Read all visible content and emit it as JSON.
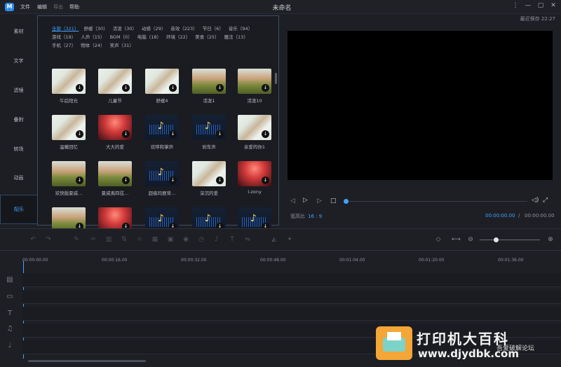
{
  "titlebar": {
    "logo": "M",
    "menu": [
      "文件",
      "编辑",
      "导出",
      "帮助"
    ],
    "title": "未命名",
    "controls": [
      "⋮",
      "—",
      "▢",
      "✕"
    ],
    "saved": "最近保存 22:27"
  },
  "nav": [
    "素材",
    "文字",
    "滤镜",
    "叠附",
    "转场",
    "动画",
    "配乐"
  ],
  "categories": [
    "全部（321）",
    "舒缓（30）",
    "活泼（30）",
    "动感（29）",
    "音效（223）",
    "节日（6）",
    "音乐（94）",
    "游戏（19）",
    "人声（15）",
    "BGM（0）",
    "电脑（18）",
    "环境（22）",
    "美食（25）",
    "魔法（13）",
    "手机（27）",
    "物体（24）",
    "笑声（31）"
  ],
  "items": [
    {
      "label": "午后阳光",
      "type": "flower"
    },
    {
      "label": "儿童节",
      "type": "flower"
    },
    {
      "label": "舒缓4",
      "type": "flower"
    },
    {
      "label": "活泼1",
      "type": "field"
    },
    {
      "label": "活泼10",
      "type": "field"
    },
    {
      "label": "温暖回忆",
      "type": "flower"
    },
    {
      "label": "大大的爱",
      "type": "concert"
    },
    {
      "label": "欢呼和掌声",
      "type": "wave"
    },
    {
      "label": "刹车声",
      "type": "wave"
    },
    {
      "label": "亲爱的你1",
      "type": "flower"
    },
    {
      "label": "欢快版夏威...",
      "type": "field"
    },
    {
      "label": "夏威夷四弦...",
      "type": "field"
    },
    {
      "label": "超级玛丽背...",
      "type": "wave"
    },
    {
      "label": "深沉的爱",
      "type": "flower"
    },
    {
      "label": "I-zony",
      "type": "concert"
    },
    {
      "label": "",
      "type": "field"
    },
    {
      "label": "",
      "type": "concert"
    },
    {
      "label": "",
      "type": "wave"
    },
    {
      "label": "",
      "type": "wave"
    },
    {
      "label": "",
      "type": "wave"
    }
  ],
  "preview": {
    "ratio_label": "宽高比",
    "ratio_value": "16 : 9",
    "current_time": "00:00:00.00",
    "separator": "/",
    "total_time": "00:00:00.00"
  },
  "ruler": [
    "00:00:00.00",
    "00:00:16.00",
    "00:00:32.00",
    "00:00:48.00",
    "00:01:04.00",
    "00:01:20.00",
    "00:01:36.00"
  ],
  "watermark": {
    "title": "打印机大百科",
    "url": "www.djydbk.com",
    "forum": "吾爱破解论坛"
  },
  "colors": {
    "accent": "#3fa3ff",
    "background": "#1e1f24",
    "panel_border": "#3a4d66"
  }
}
